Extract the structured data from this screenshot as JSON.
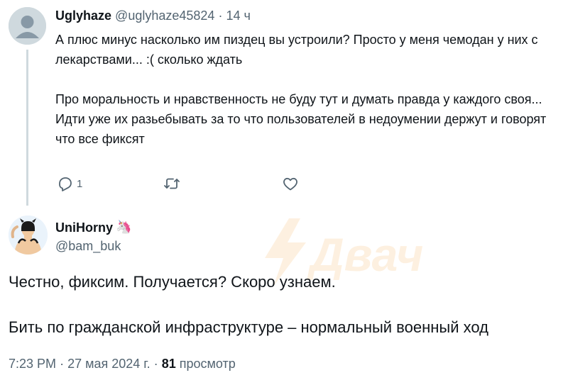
{
  "reply": {
    "display_name": "Uglyhaze",
    "handle": "@uglyhaze45824",
    "separator": "·",
    "time": "14 ч",
    "paragraphs": [
      "А плюс минус насколько им пиздец вы устроили? Просто у меня чемодан у них с лекарствами... :( сколько ждать",
      "",
      "Про моральность и нравственность не буду тут и думать правда у каждого своя...",
      "Идти уже их разьебывать за то что пользователей в недоумении держут и говорят что все фиксят"
    ],
    "actions": {
      "reply_count": "1",
      "retweet_count": "",
      "like_count": ""
    }
  },
  "tweet": {
    "display_name": "UniHorny",
    "name_emoji": "🦄",
    "handle": "@bam_buk",
    "paragraphs": [
      "Честно, фиксим. Получается? Скоро узнаем.",
      "",
      "Бить по гражданской инфраструктуре – нормальный военный ход"
    ],
    "time": "7:23 PM",
    "date": "27 мая 2024 г.",
    "views_count": "81",
    "views_label": "просмотр",
    "separator": "·"
  },
  "watermark": {
    "text": "Двач",
    "color": "#f7941d"
  },
  "icons": [
    "reply-icon",
    "retweet-icon",
    "like-icon",
    "unicorn-emoji"
  ]
}
